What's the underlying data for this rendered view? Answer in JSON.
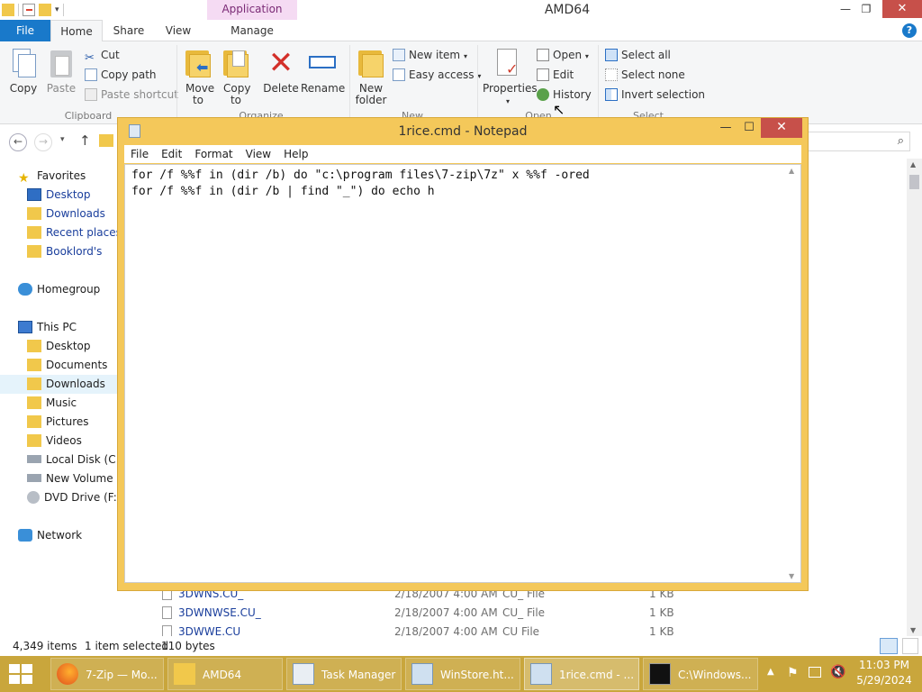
{
  "explorer": {
    "window_title": "AMD64",
    "contextual_tab_group": "Application Tools",
    "tabs": [
      "File",
      "Home",
      "Share",
      "View",
      "Manage"
    ],
    "ribbon": {
      "clipboard": {
        "label": "Clipboard",
        "copy": "Copy",
        "paste": "Paste",
        "cut": "Cut",
        "copy_path": "Copy path",
        "paste_shortcut": "Paste shortcut"
      },
      "organize": {
        "label": "Organize",
        "move_to": "Move to",
        "copy_to": "Copy to",
        "delete": "Delete",
        "rename": "Rename"
      },
      "new": {
        "label": "New",
        "new_folder": "New folder",
        "new_item": "New item",
        "easy_access": "Easy access"
      },
      "open": {
        "label": "Open",
        "properties": "Properties",
        "open": "Open",
        "edit": "Edit",
        "history": "History"
      },
      "select": {
        "label": "Select",
        "select_all": "Select all",
        "select_none": "Select none",
        "invert_selection": "Invert selection"
      }
    },
    "nav_pane": {
      "favorites": {
        "label": "Favorites",
        "items": [
          "Desktop",
          "Downloads",
          "Recent places",
          "Booklord's"
        ]
      },
      "homegroup": "Homegroup",
      "this_pc": {
        "label": "This PC",
        "items": [
          "Desktop",
          "Documents",
          "Downloads",
          "Music",
          "Pictures",
          "Videos",
          "Local Disk (C:)",
          "New Volume (D",
          "DVD Drive (F:) C"
        ]
      },
      "network": "Network",
      "selected": "Downloads"
    },
    "files": [
      {
        "name": "3DWNS.CU_",
        "date": "2/18/2007 4:00 AM",
        "type": "CU_ File",
        "size": "1 KB"
      },
      {
        "name": "3DWNWSE.CU_",
        "date": "2/18/2007 4:00 AM",
        "type": "CU_ File",
        "size": "1 KB"
      },
      {
        "name": "3DWWE.CU",
        "date": "2/18/2007 4:00 AM",
        "type": "CU File",
        "size": "1 KB"
      }
    ],
    "status": {
      "item_count": "4,349 items",
      "selected": "1 item selected",
      "size": "110 bytes"
    }
  },
  "notepad": {
    "title": "1rice.cmd - Notepad",
    "menu": [
      "File",
      "Edit",
      "Format",
      "View",
      "Help"
    ],
    "lines": [
      "for /f %%f in (dir /b) do \"c:\\program files\\7-zip\\7z\" x %%f -ored",
      "for /f %%f in (dir /b | find \"_\") do echo h"
    ]
  },
  "taskbar": {
    "items": [
      "7-Zip — Mo...",
      "AMD64",
      "Task Manager",
      "WinStore.ht...",
      "1rice.cmd - ...",
      "C:\\Windows..."
    ],
    "active": "1rice.cmd - ...",
    "time": "11:03 PM",
    "date": "5/29/2024"
  },
  "colors": {
    "accent": "#1979ca",
    "taskbar": "#c9a63c",
    "notepad_frame": "#f4c85a",
    "close": "#c7504a",
    "contextual": "#f5dbf3"
  }
}
